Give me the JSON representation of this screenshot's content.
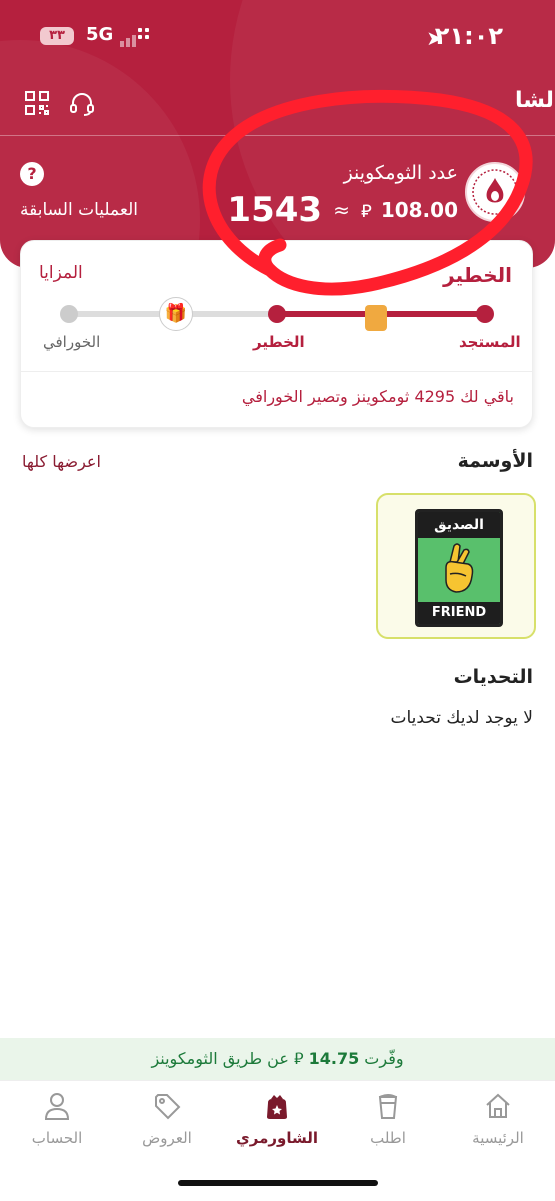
{
  "status_bar": {
    "time": "٢١:٠٢",
    "network": "5G",
    "battery": "٣٣"
  },
  "header": {
    "title": "الشا",
    "coins_label": "عدد الثومكوينز",
    "coins_count": "1543",
    "approx": "≈",
    "coins_value": "108.00",
    "currency_symbol": "⃁",
    "previous_operations": "العمليات السابقة",
    "help_symbol": "?"
  },
  "level_card": {
    "current_level_title": "الخطير",
    "perks_label": "المزايا",
    "levels": [
      "المستجد",
      "الخطير",
      "الخورافي"
    ],
    "remaining_text": "باقي لك 4295 ثومكوينز وتصير الخورافي"
  },
  "badges_section": {
    "title": "الأوسمة",
    "see_all": "اعرضها كلها",
    "items": [
      {
        "title_ar": "الصديق",
        "title_en": "FRIEND"
      }
    ]
  },
  "challenges_section": {
    "title": "التحديات",
    "empty_text": "لا يوجد لديك تحديات"
  },
  "savings_banner": {
    "prefix": "وفّرت",
    "amount": "14.75",
    "suffix": "عن طريق الثومكوينز"
  },
  "tab_bar": {
    "items": [
      {
        "label": "الرئيسية",
        "icon": "home-icon"
      },
      {
        "label": "اطلب",
        "icon": "cup-icon"
      },
      {
        "label": "الشاورمري",
        "icon": "bag-icon",
        "active": true
      },
      {
        "label": "العروض",
        "icon": "tag-icon"
      },
      {
        "label": "الحساب",
        "icon": "person-icon"
      }
    ]
  },
  "colors": {
    "brand": "#b5203e",
    "active_tab": "#7a1a2c",
    "savings_text": "#1c7a3a",
    "annotation": "#ff1f2d"
  }
}
